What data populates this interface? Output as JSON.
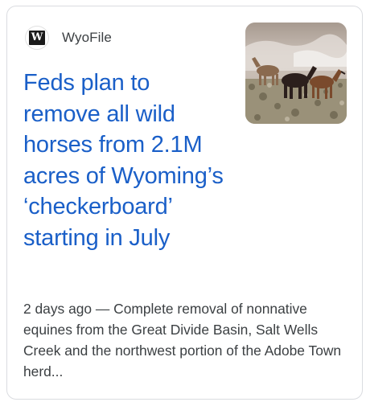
{
  "article": {
    "source_name": "WyoFile",
    "source_logo_letter": "W",
    "headline": "Feds plan to remove all wild horses from 2.1M acres of Wyoming’s ‘checkerboard’ starting in July",
    "snippet": "2 days ago — Complete removal of nonnative equines from the Great Divide Basin, Salt Wells Creek and the northwest portion of the Adobe Town herd...",
    "thumbnail_icon": "wild-horses-photo"
  }
}
